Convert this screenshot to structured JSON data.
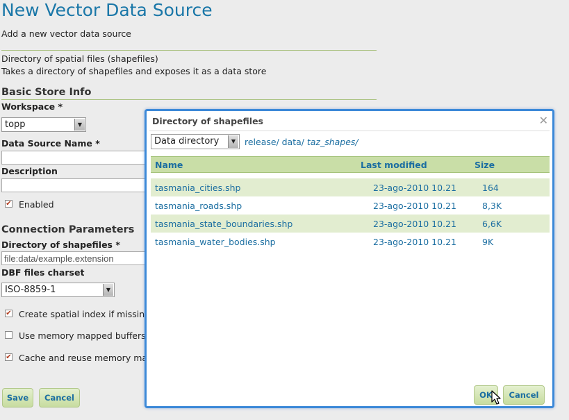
{
  "page": {
    "title": "New Vector Data Source",
    "subtitle": "Add a new vector data source",
    "store_type": "Directory of spatial files (shapefiles)",
    "store_description": "Takes a directory of shapefiles and exposes it as a data store"
  },
  "basic": {
    "heading": "Basic Store Info",
    "workspace_label": "Workspace *",
    "workspace_value": "topp",
    "name_label": "Data Source Name *",
    "name_value": "",
    "description_label": "Description",
    "description_value": "",
    "enabled_label": "Enabled",
    "enabled_checked": true
  },
  "connection": {
    "heading": "Connection Parameters",
    "dir_label": "Directory of shapefiles *",
    "dir_value": "file:data/example.extension",
    "charset_label": "DBF files charset",
    "charset_value": "ISO-8859-1",
    "spatial_index_label": "Create spatial index if missing/",
    "spatial_index_checked": true,
    "memory_mapped_label": "Use memory mapped buffers",
    "memory_mapped_checked": false,
    "cache_label": "Cache and reuse memory map",
    "cache_checked": true
  },
  "form_buttons": {
    "save": "Save",
    "cancel": "Cancel"
  },
  "dialog": {
    "title": "Directory of shapefiles",
    "root_select": "Data directory",
    "path": [
      "release/",
      "data/",
      "taz_shapes/"
    ],
    "columns": [
      "Name",
      "Last modified",
      "Size"
    ],
    "files": [
      {
        "name": "tasmania_cities.shp",
        "modified": "23-ago-2010 10.21",
        "size": "164"
      },
      {
        "name": "tasmania_roads.shp",
        "modified": "23-ago-2010 10.21",
        "size": "8,3K"
      },
      {
        "name": "tasmania_state_boundaries.shp",
        "modified": "23-ago-2010 10.21",
        "size": "6,6K"
      },
      {
        "name": "tasmania_water_bodies.shp",
        "modified": "23-ago-2010 10.21",
        "size": "9K"
      }
    ],
    "ok": "OK",
    "cancel": "Cancel",
    "close_icon": "close-icon"
  },
  "colors": {
    "accent": "#1a77a8",
    "dialog_border": "#3c89d8",
    "row_highlight": "#e2edd0",
    "header_bg": "#c9dea7"
  }
}
